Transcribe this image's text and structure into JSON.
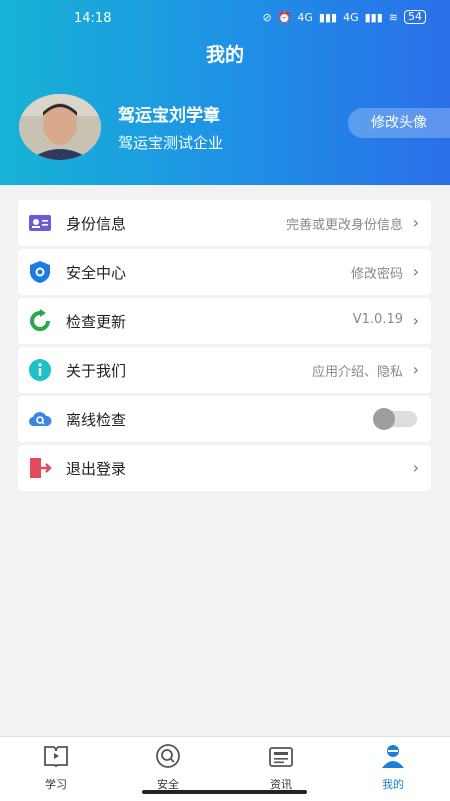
{
  "status": {
    "time": "14:18",
    "battery": "54",
    "net1": "4G",
    "net2": "4G"
  },
  "header": {
    "title": "我的",
    "user_name": "驾运宝刘学章",
    "company": "驾运宝测试企业",
    "change_avatar_label": "修改头像"
  },
  "menu": {
    "items": [
      {
        "label": "身份信息",
        "value": "完善或更改身份信息",
        "icon": "id-card-icon",
        "color": "#6a5cd8"
      },
      {
        "label": "安全中心",
        "value": "修改密码",
        "icon": "shield-icon",
        "color": "#1f7ae0"
      },
      {
        "label": "检查更新",
        "value": "V1.0.19",
        "icon": "refresh-icon",
        "color": "#2aa84a"
      },
      {
        "label": "关于我们",
        "value": "应用介绍、隐私",
        "icon": "info-icon",
        "color": "#1cc0c7"
      },
      {
        "label": "离线检查",
        "value": "",
        "icon": "cloud-search-icon",
        "color": "#3a86e3",
        "toggle_on": false
      },
      {
        "label": "退出登录",
        "value": "",
        "icon": "exit-icon",
        "color": "#e64a5a"
      }
    ]
  },
  "tabs": [
    {
      "label": "学习",
      "icon": "book-icon"
    },
    {
      "label": "安全",
      "icon": "search-circle-icon"
    },
    {
      "label": "资讯",
      "icon": "news-icon"
    },
    {
      "label": "我的",
      "icon": "user-icon",
      "active": true
    }
  ],
  "colors": {
    "accent": "#1e7fd8",
    "header_start": "#17b3d6",
    "header_end": "#2a6fe8"
  }
}
